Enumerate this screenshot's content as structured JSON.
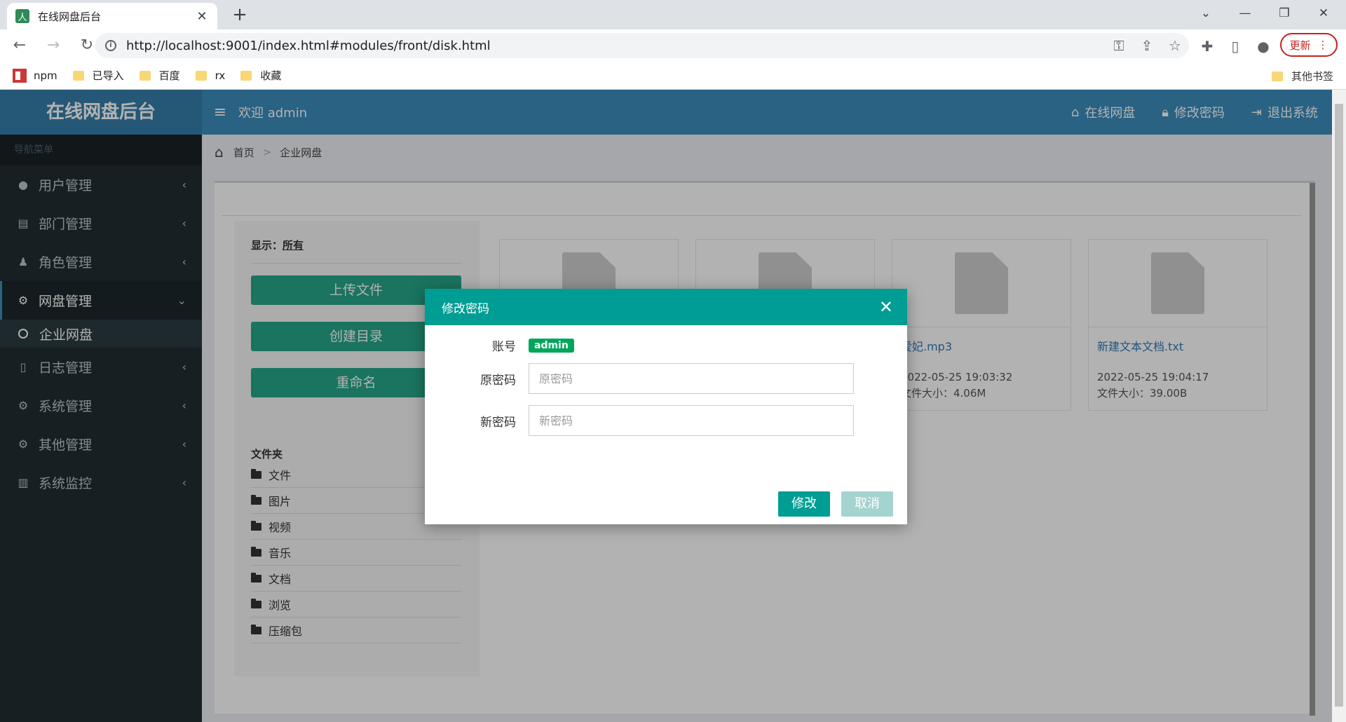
{
  "browser": {
    "tab_title": "在线网盘后台",
    "url": "http://localhost:9001/index.html#modules/front/disk.html",
    "update_label": "更新",
    "bookmarks": [
      "npm",
      "已导入",
      "百度",
      "rx",
      "收藏"
    ],
    "other_bookmarks": "其他书签"
  },
  "sidebar": {
    "brand": "在线网盘后台",
    "nav_header": "导航菜单",
    "items": [
      {
        "label": "用户管理",
        "icon": "user-icon"
      },
      {
        "label": "部门管理",
        "icon": "id-card-icon"
      },
      {
        "label": "角色管理",
        "icon": "user-secret-icon"
      },
      {
        "label": "网盘管理",
        "icon": "gear-icon"
      },
      {
        "label": "日志管理",
        "icon": "file-icon"
      },
      {
        "label": "系统管理",
        "icon": "gear-icon"
      },
      {
        "label": "其他管理",
        "icon": "gear-icon"
      },
      {
        "label": "系统监控",
        "icon": "bar-chart-icon"
      }
    ],
    "subitem": "企业网盘"
  },
  "topbar": {
    "welcome": "欢迎 admin",
    "links": [
      "在线网盘",
      "修改密码",
      "退出系统"
    ]
  },
  "breadcrumb": {
    "home": "首页",
    "current": "企业网盘"
  },
  "leftpanel": {
    "show_label": "显示：",
    "show_value": "所有",
    "buttons": [
      "上传文件",
      "创建目录",
      "重命名"
    ],
    "folders_title": "文件夹",
    "folders": [
      "文件",
      "图片",
      "视频",
      "音乐",
      "文档",
      "浏览",
      "压缩包"
    ]
  },
  "files": [
    {
      "name": "",
      "time": "",
      "size": ""
    },
    {
      "name": "",
      "time": "",
      "size": ""
    },
    {
      "name": "爱妃.mp3",
      "time": "2022-05-25 19:03:32",
      "size": "文件大小：4.06M"
    },
    {
      "name": "新建文本文档.txt",
      "time": "2022-05-25 19:04:17",
      "size": "文件大小：39.00B"
    }
  ],
  "modal": {
    "title": "修改密码",
    "account_label": "账号",
    "account_value": "admin",
    "old_label": "原密码",
    "old_placeholder": "原密码",
    "new_label": "新密码",
    "new_placeholder": "新密码",
    "confirm": "修改",
    "cancel": "取消"
  }
}
